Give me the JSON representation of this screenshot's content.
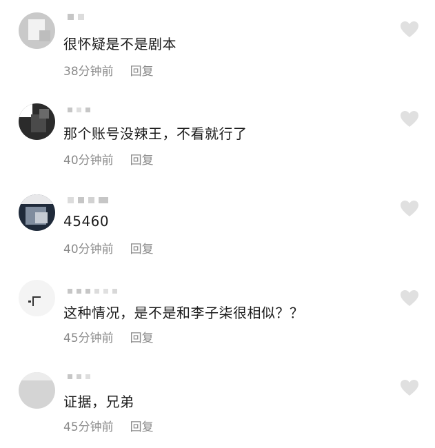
{
  "comments": [
    {
      "text": "很怀疑是不是剧本",
      "time": "38分钟前",
      "reply": "回复",
      "like_icon": "heart-outline-icon"
    },
    {
      "text": "那个账号没辣王，不看就行了",
      "time": "40分钟前",
      "reply": "回复",
      "like_icon": "heart-outline-icon"
    },
    {
      "text": "45460",
      "time": "40分钟前",
      "reply": "回复",
      "like_icon": "heart-outline-icon"
    },
    {
      "text": "这种情况，是不是和李子柒很相似？？",
      "time": "45分钟前",
      "reply": "回复",
      "like_icon": "heart-outline-icon"
    },
    {
      "text": "证据，兄弟",
      "time": "45分钟前",
      "reply": "回复",
      "like_icon": "heart-outline-icon"
    }
  ],
  "colors": {
    "text": "#1c1c1c",
    "meta": "#8a8a8a",
    "heart": "#e0e0e0",
    "background": "#ffffff"
  }
}
